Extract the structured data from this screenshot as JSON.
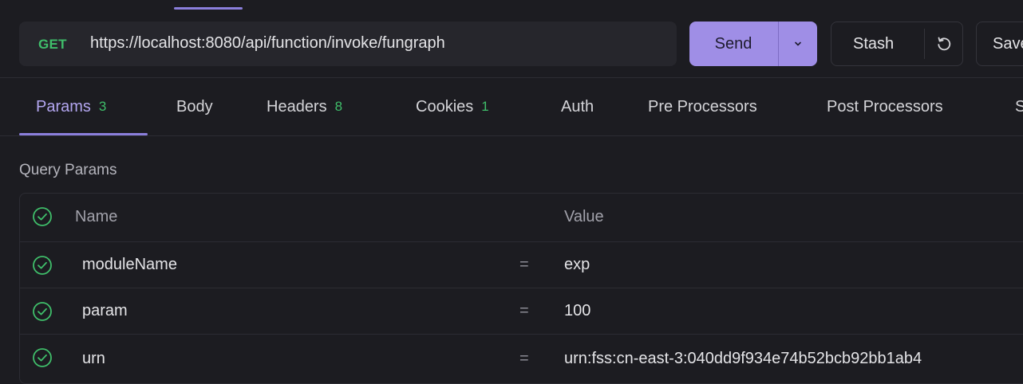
{
  "request": {
    "method": "GET",
    "url": "https://localhost:8080/api/function/invoke/fungraph"
  },
  "actions": {
    "send_label": "Send",
    "stash_label": "Stash",
    "save_label": "Save"
  },
  "tabs": [
    {
      "label": "Params",
      "count": "3",
      "active": true
    },
    {
      "label": "Body",
      "count": ""
    },
    {
      "label": "Headers",
      "count": "8"
    },
    {
      "label": "Cookies",
      "count": "1"
    },
    {
      "label": "Auth",
      "count": ""
    },
    {
      "label": "Pre Processors",
      "count": ""
    },
    {
      "label": "Post Processors",
      "count": ""
    },
    {
      "label": "Settings",
      "count": ""
    }
  ],
  "query_params": {
    "title": "Query Params",
    "columns": {
      "name": "Name",
      "value": "Value"
    },
    "rows": [
      {
        "name": "moduleName",
        "value": "exp"
      },
      {
        "name": "param",
        "value": "100"
      },
      {
        "name": "urn",
        "value": "urn:fss:cn-east-3:040dd9f934e74b52bcb92bb1ab4"
      }
    ]
  },
  "colors": {
    "accent": "#9f8ee6",
    "method_get": "#3fbe6a",
    "background": "#1c1c21"
  }
}
